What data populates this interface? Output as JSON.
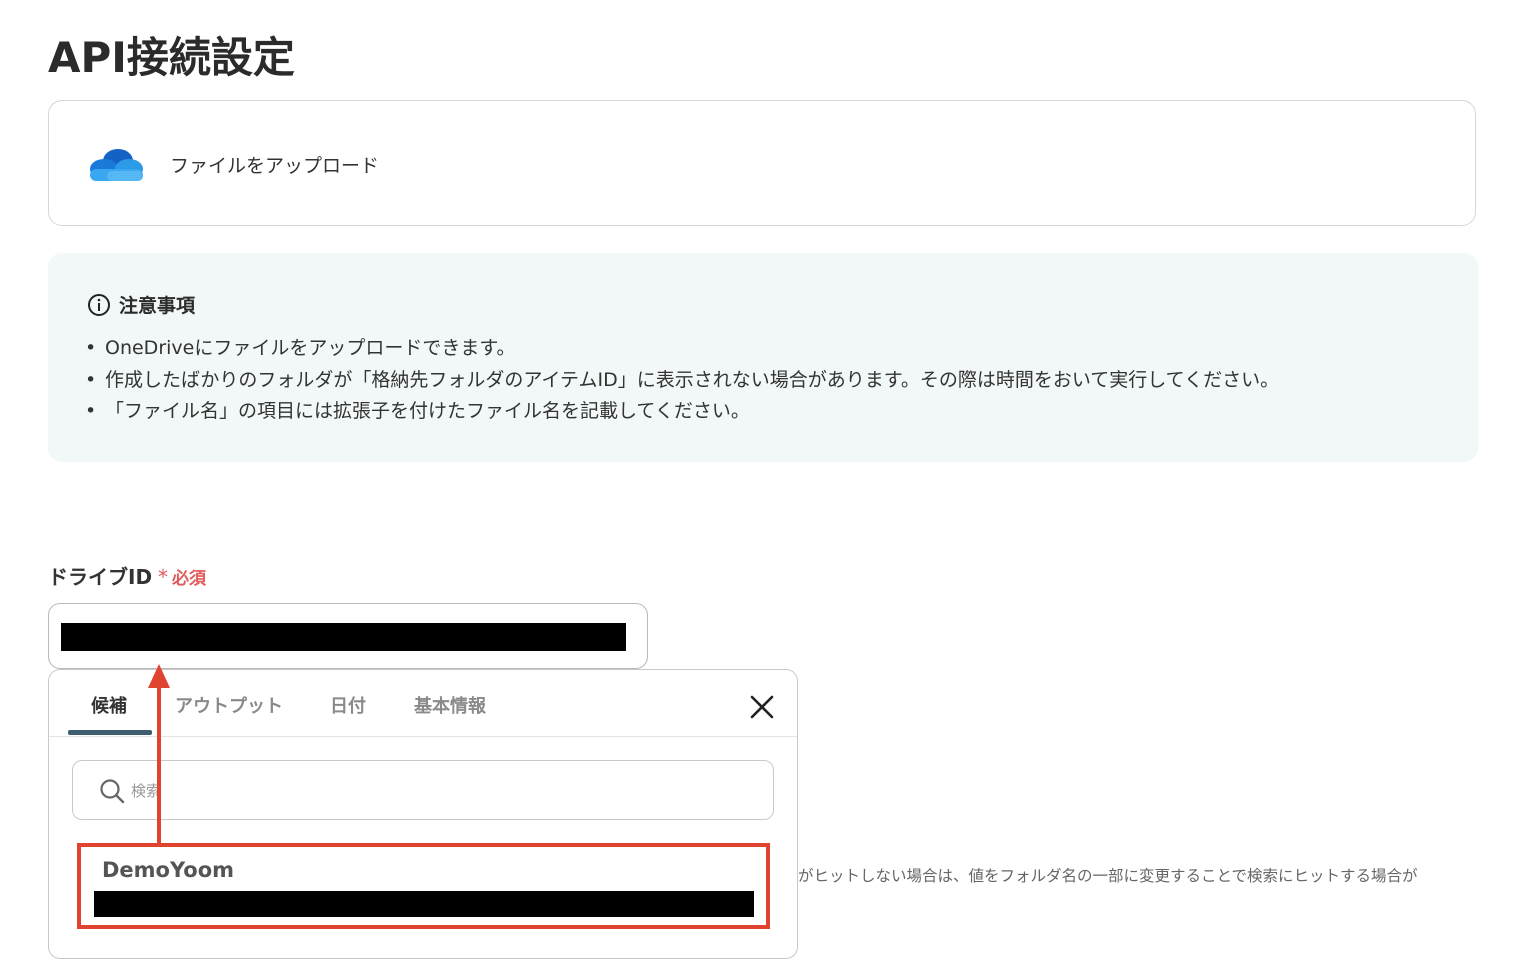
{
  "page": {
    "title": "API接続設定"
  },
  "app": {
    "icon": "onedrive-icon",
    "action": "ファイルをアップロード"
  },
  "notice": {
    "icon": "info-icon",
    "title": "注意事項",
    "bullet": "•",
    "items": [
      "OneDriveにファイルをアップロードできます。",
      "作成したばかりのフォルダが「格納先フォルダのアイテムID」に表示されない場合があります。その際は時間をおいて実行してください。",
      "「ファイル名」の項目には拡張子を付けたファイル名を記載してください。"
    ]
  },
  "field": {
    "label": "ドライブID",
    "required_mark": "*",
    "required_text": "必須"
  },
  "hint": "がヒットしない場合は、値をフォルダ名の一部に変更することで検索にヒットする場合が",
  "dropdown": {
    "tabs": [
      {
        "label": "候補",
        "active": true
      },
      {
        "label": "アウトプット",
        "active": false
      },
      {
        "label": "日付",
        "active": false
      },
      {
        "label": "基本情報",
        "active": false
      }
    ],
    "search": {
      "placeholder": "検索",
      "value": ""
    },
    "options": [
      {
        "name": "DemoYoom"
      }
    ],
    "close_icon": "close-icon"
  },
  "colors": {
    "accent": "#3e5d6e",
    "required": "#e05b5b",
    "annotation": "#e0432f",
    "notice_bg": "#f2f7f7"
  }
}
